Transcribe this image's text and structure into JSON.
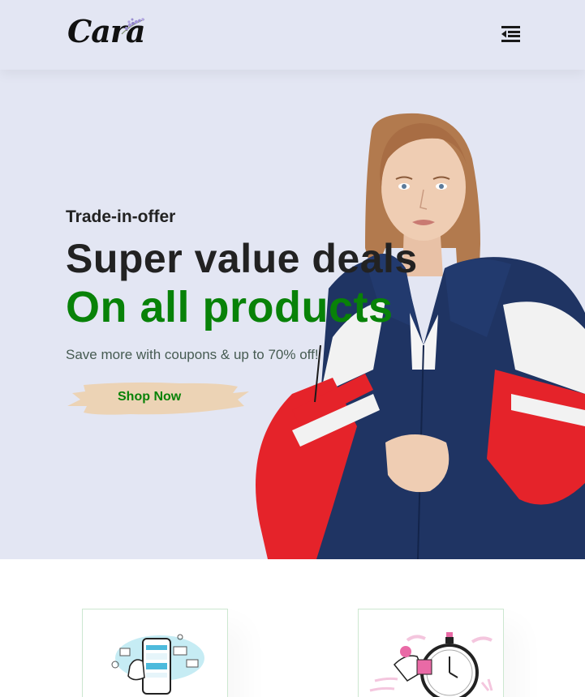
{
  "header": {
    "logo_text": "Cara",
    "menu_icon": "menu-icon"
  },
  "hero": {
    "kicker": "Trade-in-offer",
    "headline": "Super value deals",
    "subheadline": "On all products",
    "tagline": "Save more with coupons & up to 70% off!",
    "cta_label": "Shop Now"
  },
  "features": {
    "cards": [
      {
        "icon": "online-payment-illustration"
      },
      {
        "icon": "fast-delivery-illustration"
      }
    ]
  },
  "colors": {
    "background": "#e3e6f3",
    "accent_green": "#088208",
    "cta_brush": "#ecd3b5",
    "card_border": "#cce7d0"
  }
}
